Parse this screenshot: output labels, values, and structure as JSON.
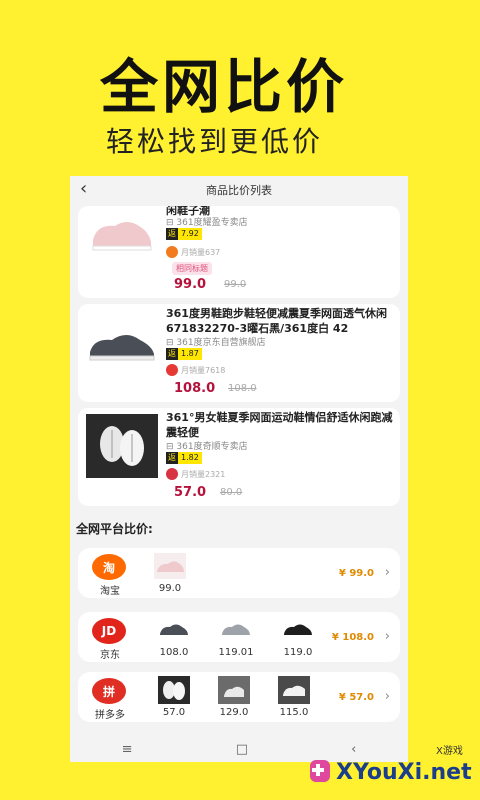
{
  "hero": {
    "title": "全网比价",
    "subtitle": "轻松找到更低价"
  },
  "screen": {
    "title": "商品比价列表",
    "products": [
      {
        "title": "闲鞋子潮",
        "store": "⊟ 361度耀盈专卖店",
        "rebate_tag": "返",
        "rebate": "7.92",
        "sales": "月销量637",
        "label": "相同标题",
        "price": "99.0",
        "old_price": "99.0",
        "platform_icon_color": "#F27B1F"
      },
      {
        "title": "361度男鞋跑步鞋轻便减震夏季网面透气休闲 671832270-3曜石黑/361度白 42",
        "store": "⊟ 361度京东自营旗舰店",
        "rebate_tag": "返",
        "rebate": "1.87",
        "sales": "月销量7618",
        "price": "108.0",
        "old_price": "108.0",
        "platform_icon_color": "#E53935"
      },
      {
        "title": "361°男女鞋夏季网面运动鞋情侣舒适休闲跑减震轻便",
        "store": "⊟ 361度奇顺专卖店",
        "rebate_tag": "返",
        "rebate": "1.82",
        "sales": "月销量2321",
        "price": "57.0",
        "old_price": "80.0",
        "platform_icon_color": "#D83340"
      }
    ],
    "compare_section_title": "全网平台比价:",
    "platforms": [
      {
        "name": "淘宝",
        "logo_text": "淘",
        "logo_color": "#FF6A00",
        "items": [
          "99.0"
        ],
        "best_price": "¥ 99.0"
      },
      {
        "name": "京东",
        "logo_text": "JD",
        "logo_color": "#E1251B",
        "items": [
          "108.0",
          "119.01",
          "119.0"
        ],
        "best_price": "¥ 108.0"
      },
      {
        "name": "拼多多",
        "logo_text": "拼",
        "logo_color": "#E02E24",
        "items": [
          "57.0",
          "129.0",
          "115.0"
        ],
        "best_price": "¥ 57.0"
      }
    ],
    "nav": [
      "≡",
      "□",
      "‹"
    ]
  },
  "watermark": {
    "top_text": "X游戏",
    "text": "XYouXi.net"
  },
  "colors": {
    "background": "#FFF12F",
    "price_red": "#B5123B",
    "best_price_orange": "#E08A00"
  }
}
